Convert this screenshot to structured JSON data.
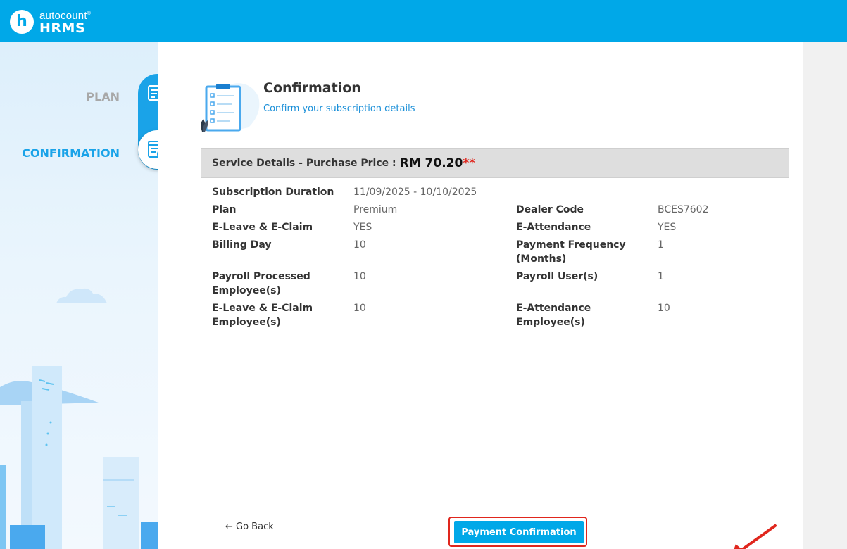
{
  "brand": {
    "logo_letter": "h",
    "name_top": "autocount",
    "trademark": "®",
    "name_bottom": "HRMS"
  },
  "steps": [
    {
      "label": "PLAN",
      "state": "done",
      "icon": "edit-form-icon"
    },
    {
      "label": "CONFIRMATION",
      "state": "active",
      "icon": "checklist-check-icon"
    }
  ],
  "header": {
    "title": "Confirmation",
    "subtitle": "Confirm your subscription details"
  },
  "service": {
    "heading": "Service Details - Purchase Price :",
    "price": "RM 70.20",
    "price_marker": "**",
    "fields": {
      "subscription_duration": {
        "label": "Subscription Duration",
        "value": "11/09/2025 - 10/10/2025"
      },
      "plan": {
        "label": "Plan",
        "value": "Premium"
      },
      "dealer_code": {
        "label": "Dealer Code",
        "value": "BCES7602"
      },
      "eleave_eclaim": {
        "label": "E-Leave & E-Claim",
        "value": "YES"
      },
      "eattendance": {
        "label": "E-Attendance",
        "value": "YES"
      },
      "billing_day": {
        "label": "Billing Day",
        "value": "10"
      },
      "payment_frequency_l1": {
        "label": "Payment Frequency"
      },
      "payment_frequency_l2": {
        "label": "(Months)",
        "value": "1"
      },
      "payroll_employees_l1": {
        "label": "Payroll Processed"
      },
      "payroll_employees_l2": {
        "label": "Employee(s)",
        "value": "10"
      },
      "payroll_users": {
        "label": "Payroll User(s)",
        "value": "1"
      },
      "eleave_employees_l1": {
        "label": "E-Leave & E-Claim"
      },
      "eleave_employees_l2": {
        "label": "Employee(s)",
        "value": "10"
      },
      "eattendance_employees_l1": {
        "label": "E-Attendance"
      },
      "eattendance_employees_l2": {
        "label": "Employee(s)",
        "value": "10"
      }
    }
  },
  "footer": {
    "back_label": "← Go Back",
    "pay_label": "Payment Confirmation"
  },
  "colors": {
    "brand": "#00a8e8",
    "active_step": "#1aa3e8",
    "inactive_step": "#a8a8a8",
    "highlight": "#e0261d"
  }
}
